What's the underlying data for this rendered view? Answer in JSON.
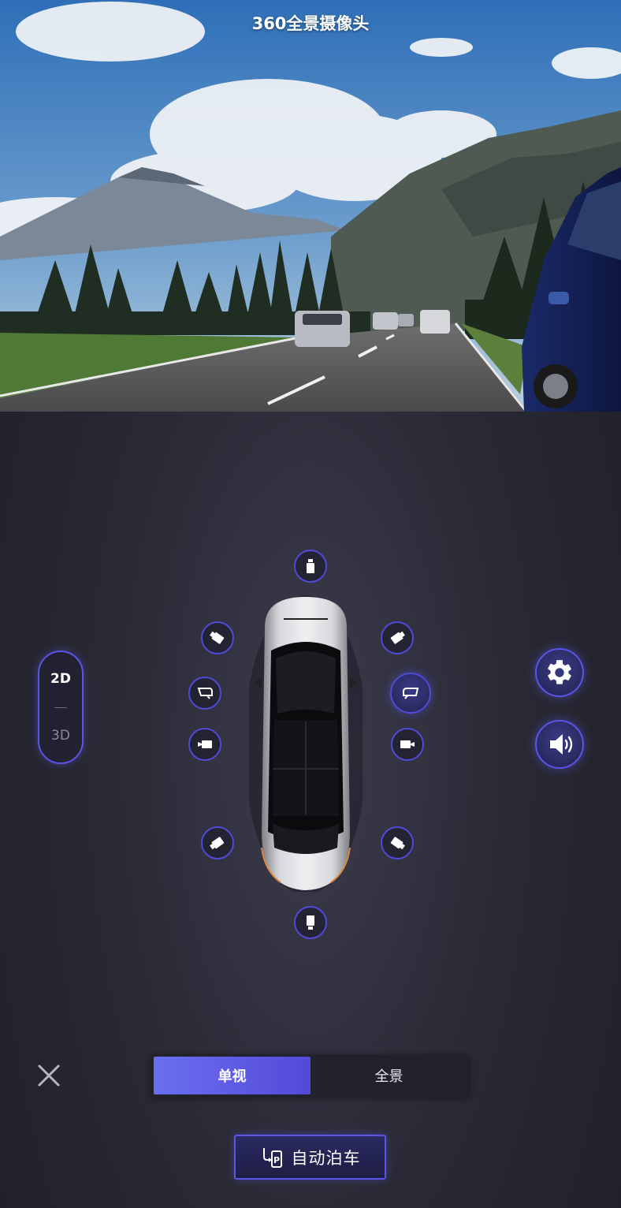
{
  "feed": {
    "title": "360全景摄像头"
  },
  "view_mode": {
    "options": [
      "2D",
      "3D"
    ],
    "selected": "2D"
  },
  "side_buttons": {
    "settings_icon": "gear-icon",
    "sound_icon": "speaker-icon"
  },
  "cameras": {
    "selected": "right-mirror",
    "nodes": [
      "front",
      "front-left",
      "front-right",
      "left-mirror",
      "right-mirror",
      "left-side",
      "right-side",
      "rear-left",
      "rear-right",
      "rear"
    ]
  },
  "segment": {
    "single_label": "单视",
    "panorama_label": "全景",
    "selected": "单视"
  },
  "auto_park": {
    "label": "自动泊车",
    "icon": "park-entry-icon"
  },
  "colors": {
    "accent": "#5a55e8",
    "accent_gradient_start": "#6a6ff0",
    "background": "#2a2a36"
  }
}
